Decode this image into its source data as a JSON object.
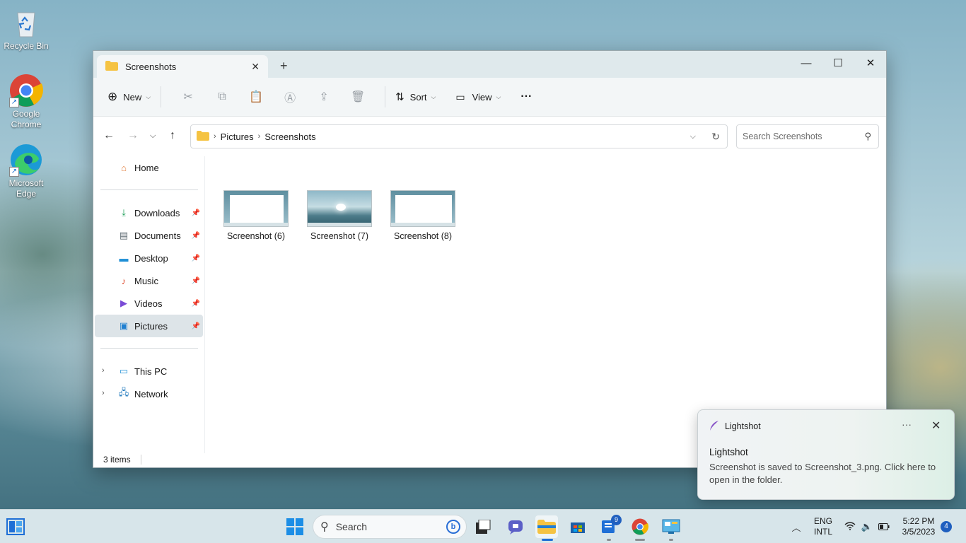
{
  "desktop": {
    "icons": [
      {
        "label": "Recycle Bin"
      },
      {
        "label": "Google Chrome"
      },
      {
        "label": "Microsoft Edge"
      }
    ]
  },
  "window": {
    "tab_title": "Screenshots",
    "toolbar": {
      "new_label": "New",
      "sort_label": "Sort",
      "view_label": "View",
      "more_label": "···"
    },
    "address": {
      "crumbs": [
        "Pictures",
        "Screenshots"
      ],
      "search_placeholder": "Search Screenshots"
    },
    "sidebar": {
      "home": "Home",
      "quick_access": [
        {
          "label": "Downloads"
        },
        {
          "label": "Documents"
        },
        {
          "label": "Desktop"
        },
        {
          "label": "Music"
        },
        {
          "label": "Videos"
        },
        {
          "label": "Pictures"
        }
      ],
      "this_pc": "This PC",
      "network": "Network"
    },
    "files": [
      {
        "name": "Screenshot (6)"
      },
      {
        "name": "Screenshot (7)"
      },
      {
        "name": "Screenshot (8)"
      }
    ],
    "status": "3 items"
  },
  "notification": {
    "app_name": "Lightshot",
    "more": "···",
    "heading": "Lightshot",
    "body": "Screenshot is saved to Screenshot_3.png. Click here to open in the folder."
  },
  "taskbar": {
    "search_label": "Search",
    "store_badge": "9",
    "language_line1": "ENG",
    "language_line2": "INTL",
    "time": "5:22 PM",
    "date": "3/5/2023",
    "notification_count": "4"
  }
}
